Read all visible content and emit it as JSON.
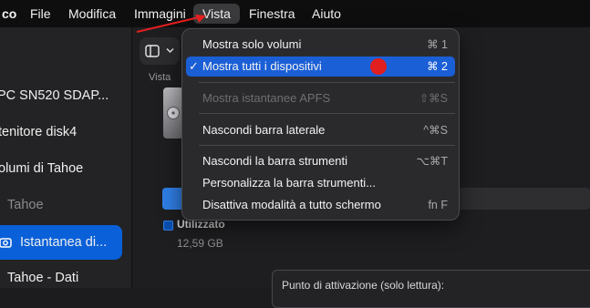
{
  "menubar": {
    "app_name": "co",
    "items": [
      "File",
      "Modifica",
      "Immagini",
      "Vista",
      "Finestra",
      "Aiuto"
    ]
  },
  "toolbar": {
    "view_button_label": "Vista"
  },
  "sidebar": {
    "items": [
      "PC SN520 SDAP...",
      "tenitore disk4",
      "olumi di Tahoe",
      "Tahoe",
      "Istantanea di...",
      "Tahoe - Dati"
    ]
  },
  "main": {
    "legend_label": "Utilizzato",
    "legend_value": "12,59 GB",
    "info_text": "Punto di attivazione (solo lettura):"
  },
  "view_menu": {
    "items": [
      {
        "label": "Mostra solo volumi",
        "shortcut": "⌘ 1"
      },
      {
        "label": "Mostra tutti i dispositivi",
        "shortcut": "⌘ 2",
        "checked": "✓"
      },
      {
        "label": "Mostra istantanee APFS",
        "shortcut": "⇧⌘S"
      },
      {
        "label": "Nascondi barra laterale",
        "shortcut": "^⌘S"
      },
      {
        "label": "Nascondi la barra strumenti",
        "shortcut": "⌥⌘T"
      },
      {
        "label": "Personalizza la barra strumenti...",
        "shortcut": ""
      },
      {
        "label": "Disattiva modalità a tutto schermo",
        "shortcut": "fn F"
      }
    ]
  },
  "colors": {
    "accent": "#0a60d8",
    "highlight": "#1a5fd6",
    "annotation": "#e21f1f"
  },
  "icons": {
    "sidebar_toggle": "sidebar-toggle-icon",
    "disk": "internal-disk-icon",
    "snapshot": "camera-snapshot-icon",
    "annotation_arrow": "red-arrow-annotation"
  }
}
